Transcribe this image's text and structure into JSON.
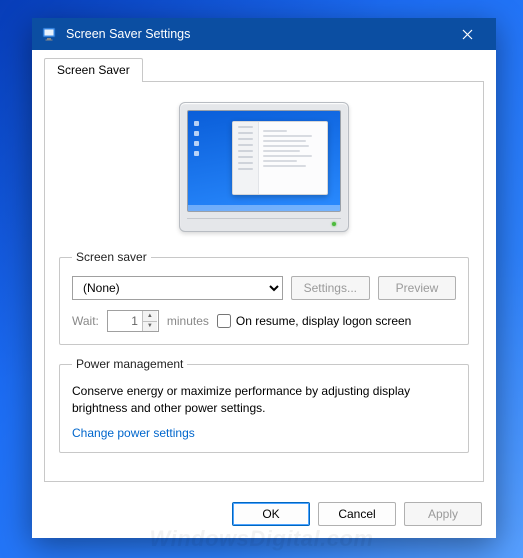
{
  "titlebar": {
    "title": "Screen Saver Settings"
  },
  "tab": {
    "label": "Screen Saver"
  },
  "screensaver_group": {
    "legend": "Screen saver",
    "dropdown_value": "(None)",
    "settings_btn": "Settings...",
    "preview_btn": "Preview",
    "wait_label": "Wait:",
    "wait_value": "1",
    "wait_unit": "minutes",
    "resume_checkbox": "On resume, display logon screen"
  },
  "power_group": {
    "legend": "Power management",
    "description": "Conserve energy or maximize performance by adjusting display brightness and other power settings.",
    "link": "Change power settings"
  },
  "footer": {
    "ok": "OK",
    "cancel": "Cancel",
    "apply": "Apply"
  },
  "watermark": "WindowsDigital.com"
}
